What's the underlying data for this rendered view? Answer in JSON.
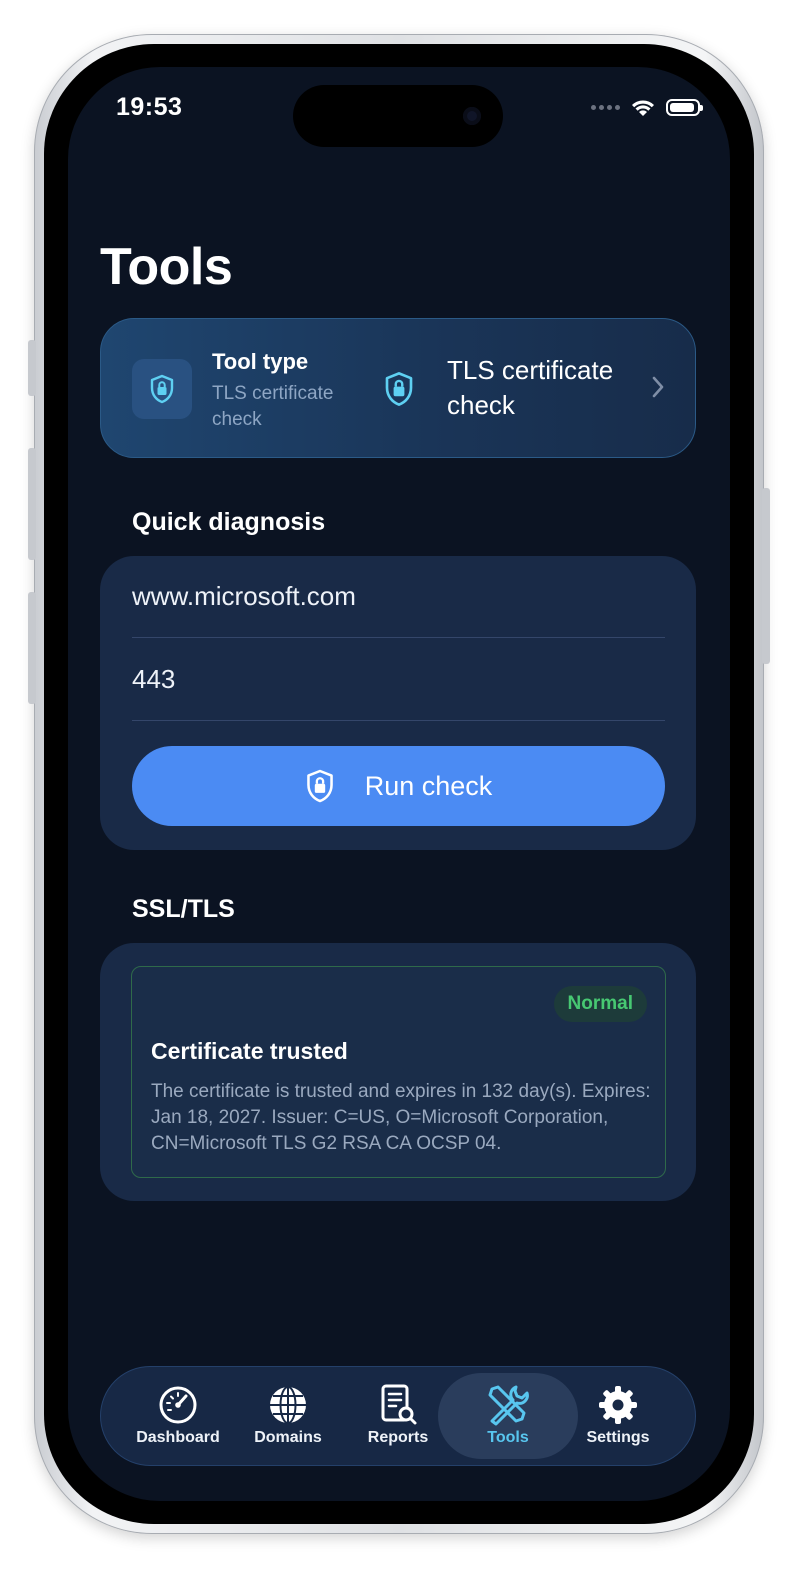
{
  "status_bar": {
    "time": "19:53"
  },
  "page": {
    "title": "Tools"
  },
  "tool_type": {
    "label": "Tool type",
    "subtitle": "TLS certificate check",
    "value": "TLS certificate check",
    "icon": "lock-shield-icon"
  },
  "quick_diagnosis": {
    "title": "Quick diagnosis",
    "host_value": "www.microsoft.com",
    "port_value": "443",
    "run_label": "Run check"
  },
  "ssl": {
    "section_title": "SSL/TLS",
    "badge": "Normal",
    "result_title": "Certificate trusted",
    "result_description": "The certificate is trusted and expires in 132 day(s). Expires: Jan 18, 2027. Issuer: C=US, O=Microsoft Corporation, CN=Microsoft TLS G2 RSA CA OCSP 04."
  },
  "tabbar": {
    "items": [
      {
        "label": "Dashboard",
        "icon": "gauge-icon"
      },
      {
        "label": "Domains",
        "icon": "globe-icon"
      },
      {
        "label": "Reports",
        "icon": "report-search-icon"
      },
      {
        "label": "Tools",
        "icon": "tools-icon"
      },
      {
        "label": "Settings",
        "icon": "gear-icon"
      }
    ],
    "active": "Tools"
  },
  "colors": {
    "background": "#0b1322",
    "card": "#192a47",
    "accent_blue": "#4b8bf3",
    "active_tab": "#58c6ef",
    "status_green": "#47c872"
  }
}
